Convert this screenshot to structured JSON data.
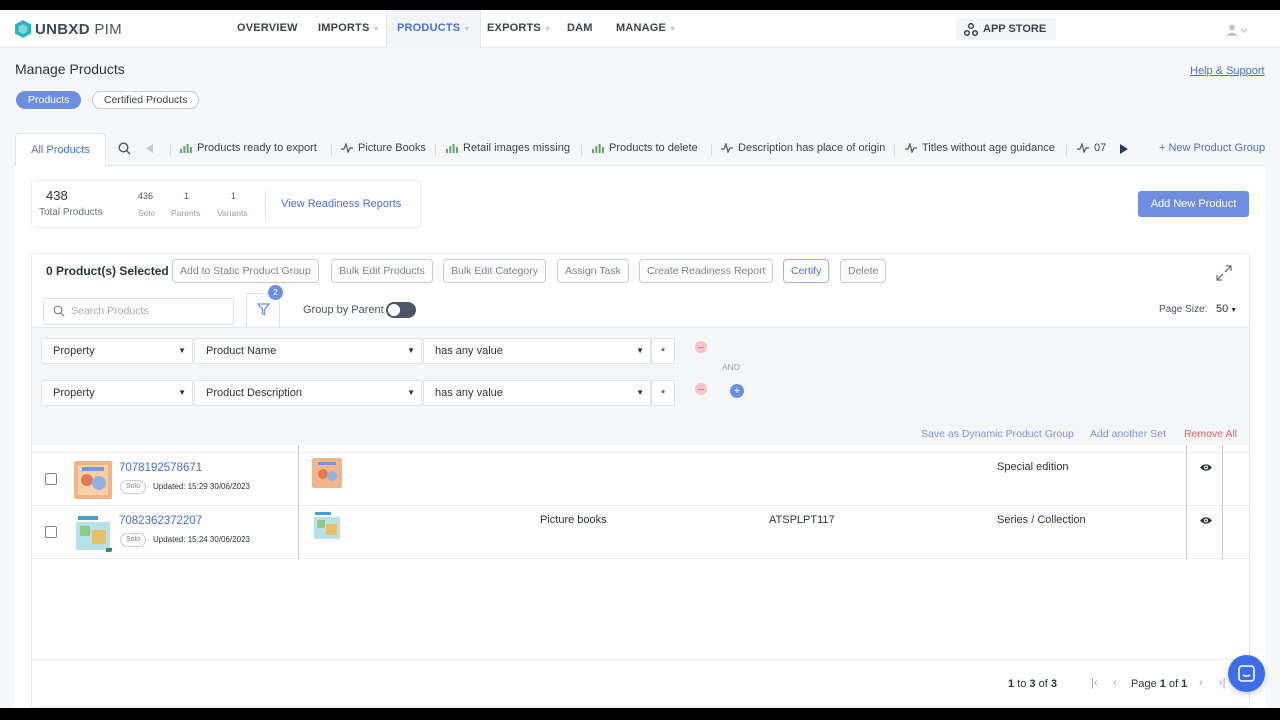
{
  "app": {
    "brand": "UNBXD",
    "product": "PIM"
  },
  "nav": {
    "items": [
      {
        "label": "OVERVIEW",
        "caret": false
      },
      {
        "label": "IMPORTS",
        "caret": true
      },
      {
        "label": "PRODUCTS",
        "caret": true,
        "active": true
      },
      {
        "label": "EXPORTS",
        "caret": true
      },
      {
        "label": "DAM",
        "caret": false
      },
      {
        "label": "MANAGE",
        "caret": true
      }
    ],
    "app_store": "APP STORE"
  },
  "header": {
    "title": "Manage Products",
    "help_link": "Help & Support",
    "pills": [
      "Products",
      "Certified Products"
    ]
  },
  "tabs": {
    "all": "All Products",
    "groups": [
      {
        "label": "Products ready to export",
        "icon": "bar-chart-icon"
      },
      {
        "label": "Picture Books",
        "icon": "pulse-icon"
      },
      {
        "label": "Retail images missing",
        "icon": "bar-chart-icon"
      },
      {
        "label": "Products to delete",
        "icon": "bar-chart-icon"
      },
      {
        "label": "Description has place of origin",
        "icon": "pulse-icon"
      },
      {
        "label": "Titles without age guidance",
        "icon": "pulse-icon"
      },
      {
        "label": "07",
        "icon": "pulse-icon"
      }
    ],
    "new_group": "+ New Product Group"
  },
  "stats": {
    "total": "438",
    "total_label": "Total Products",
    "solo": "436",
    "solo_label": "Solo",
    "parents": "1",
    "parents_label": "Parents",
    "variants": "1",
    "variants_label": "Variants",
    "readiness_link": "View Readiness Reports"
  },
  "add_new_product": "Add New Product",
  "toolbar": {
    "selected": "0 Product(s) Selected",
    "actions": [
      "Add to Static Product Group",
      "Bulk Edit Products",
      "Bulk Edit Category",
      "Assign Task",
      "Create Readiness Report",
      "Certify",
      "Delete"
    ]
  },
  "search": {
    "placeholder": "Search Products"
  },
  "filter_badge": "2",
  "group_by_parent": "Group by Parent",
  "page_size": {
    "label": "Page Size:",
    "value": "50"
  },
  "filters": {
    "rows": [
      {
        "type": "Property",
        "field": "Product Name",
        "op": "has any value",
        "value": "*"
      },
      {
        "type": "Property",
        "field": "Product Description",
        "op": "has any value",
        "value": "*"
      }
    ],
    "and_label": "AND",
    "save_dynamic": "Save as Dynamic Product Group",
    "add_set": "Add another Set",
    "remove_all": "Remove All"
  },
  "products": [
    {
      "id": "7078192578671",
      "badge": "Solo",
      "updated": "Updated: 15:29 30/06/2023",
      "category": "",
      "sku": "",
      "edition": "Special edition"
    },
    {
      "id": "7082362372207",
      "badge": "Solo",
      "updated": "Updated: 15:24 30/06/2023",
      "category": "Picture books",
      "sku": "ATSPLPT117",
      "edition": "Series / Collection"
    }
  ],
  "pagination": {
    "range_from": "1",
    "range_to": "3",
    "range_total": "3",
    "page": "1",
    "pages": "1"
  },
  "colors": {
    "accent": "#6e8fe0",
    "link": "#4a6fd6",
    "danger": "#e06068"
  }
}
